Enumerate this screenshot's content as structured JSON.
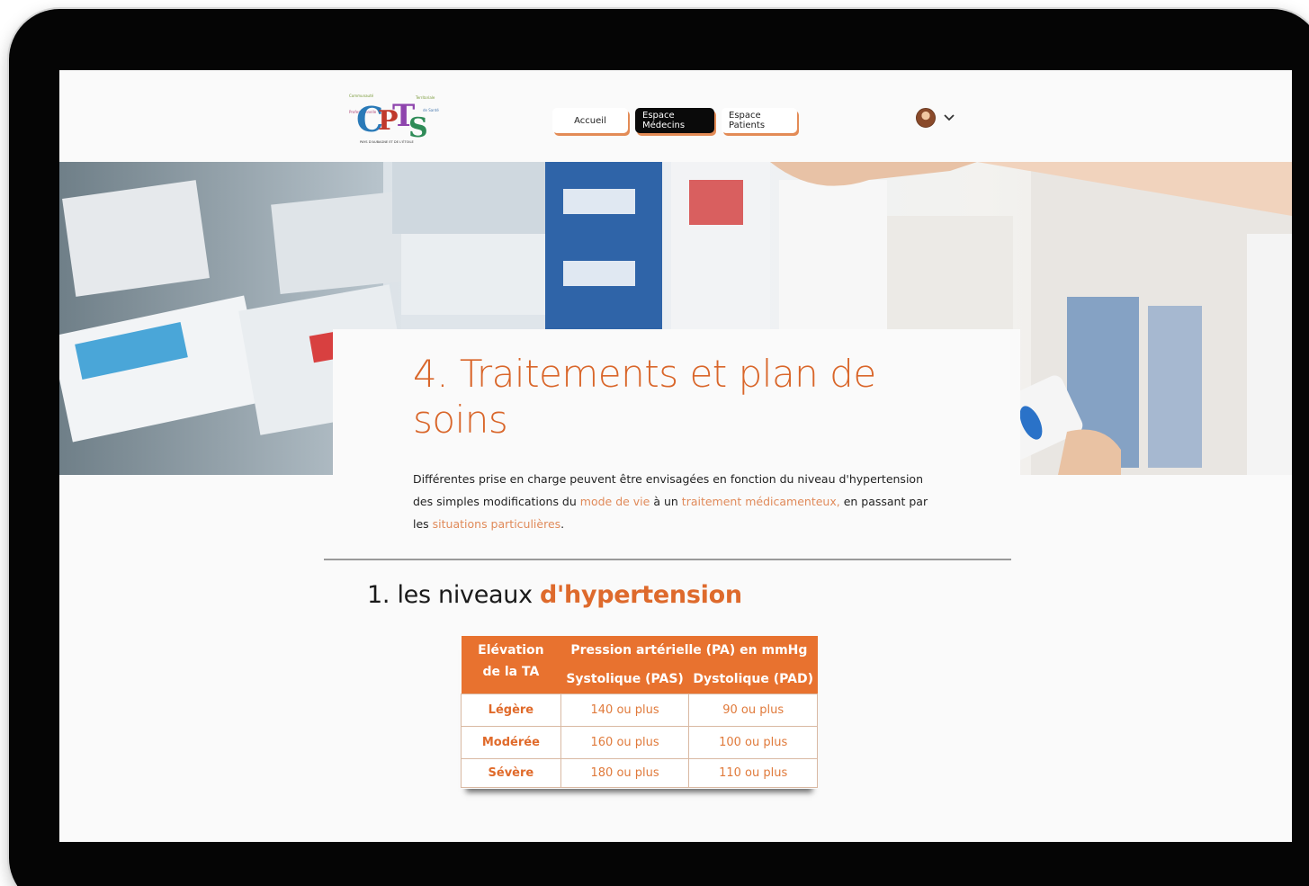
{
  "header": {
    "logo_text": "CPTS",
    "nav": [
      {
        "label": "Accueil"
      },
      {
        "label": "Espace Médecins"
      },
      {
        "label": "Espace Patients"
      }
    ]
  },
  "main": {
    "title": "4. Traitements et plan de soins",
    "intro": {
      "part1": "Différentes prise en charge peuvent être envisagées en fonction du niveau d'hypertension des simples modifications du ",
      "link1": "mode de vie",
      "part2": " à un ",
      "link2": "traitement médicamenteux,",
      "part3": " en passant par les ",
      "link3": "situations particulières",
      "part4": "."
    },
    "section_title_prefix": "1. les niveaux ",
    "section_title_accent": "d'hypertension",
    "table": {
      "header_col1": "Elévation de la TA",
      "header_group": "Pression artérielle (PA) en mmHg",
      "header_sys": "Systolique (PAS)",
      "header_dia": "Dystolique (PAD)",
      "rows": [
        {
          "level": "Légère",
          "sys": "140 ou plus",
          "dia": "90 ou plus"
        },
        {
          "level": "Modérée",
          "sys": "160 ou plus",
          "dia": "100 ou plus"
        },
        {
          "level": "Sévère",
          "sys": "180 ou plus",
          "dia": "110 ou plus"
        }
      ]
    }
  },
  "colors": {
    "accent": "#e8722f",
    "title": "#d9662a",
    "link": "#e08a5a",
    "nav_active_bg": "#0a0a0a"
  }
}
